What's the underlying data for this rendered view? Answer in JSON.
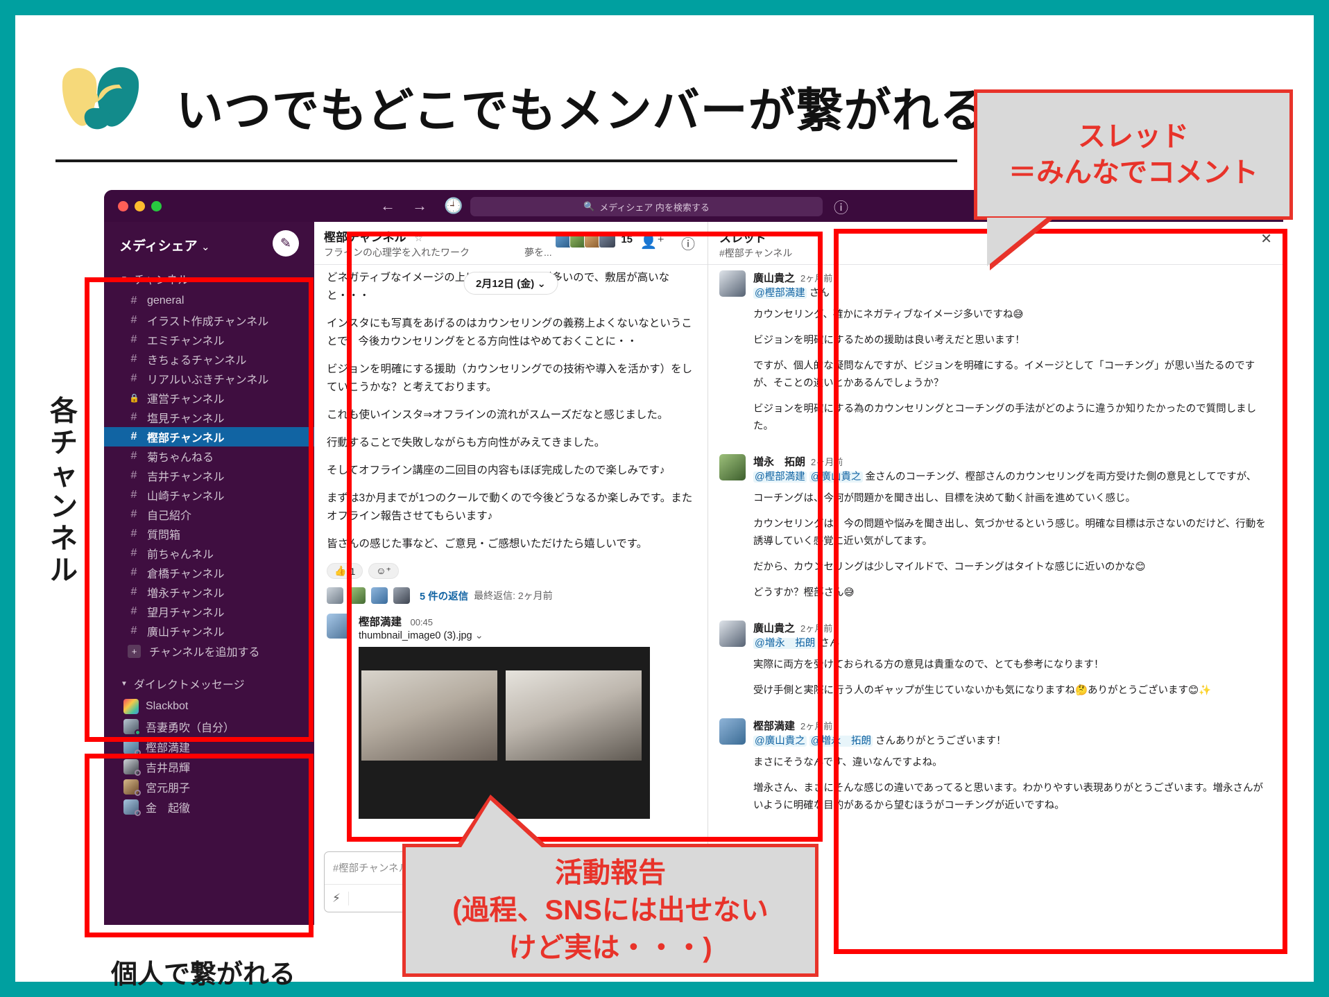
{
  "header": {
    "title": "いつでもどこでもメンバーが繋がれる",
    "logo_icon": "heart-hands-logo"
  },
  "annotations": {
    "channels_label": "各チャンネル",
    "dm_label": "個人で繋がれる",
    "thread_callout_line1": "スレッド",
    "thread_callout_line2": "＝みんなでコメント",
    "report_callout_line1": "活動報告",
    "report_callout_line2": "(過程、SNSには出せない",
    "report_callout_line3": "けど実は・・・)"
  },
  "titlebar": {
    "search_placeholder": "メディシェア 内を検索する",
    "search_icon": "search-icon",
    "back_icon": "arrow-left-icon",
    "forward_icon": "arrow-right-icon",
    "history_icon": "clock-icon",
    "help_icon": "help-circle-icon"
  },
  "sidebar": {
    "workspace_name": "メディシェア",
    "workspace_caret": "⌄",
    "compose_icon": "compose-icon",
    "channels_section": "チャンネル",
    "channels": [
      {
        "name": "general",
        "icon": "hash-icon",
        "active": false
      },
      {
        "name": "イラスト作成チャンネル",
        "icon": "hash-icon",
        "active": false
      },
      {
        "name": "エミチャンネル",
        "icon": "hash-icon",
        "active": false
      },
      {
        "name": "きちょるチャンネル",
        "icon": "hash-icon",
        "active": false
      },
      {
        "name": "リアルいぶきチャンネル",
        "icon": "hash-icon",
        "active": false
      },
      {
        "name": "運営チャンネル",
        "icon": "lock-icon",
        "active": false
      },
      {
        "name": "塩見チャンネル",
        "icon": "hash-icon",
        "active": false
      },
      {
        "name": "樫部チャンネル",
        "icon": "hash-icon",
        "active": true
      },
      {
        "name": "菊ちゃんねる",
        "icon": "hash-icon",
        "active": false
      },
      {
        "name": "吉井チャンネル",
        "icon": "hash-icon",
        "active": false
      },
      {
        "name": "山崎チャンネル",
        "icon": "hash-icon",
        "active": false
      },
      {
        "name": "自己紹介",
        "icon": "hash-icon",
        "active": false
      },
      {
        "name": "質問箱",
        "icon": "hash-icon",
        "active": false
      },
      {
        "name": "前ちゃんネル",
        "icon": "hash-icon",
        "active": false
      },
      {
        "name": "倉橋チャンネル",
        "icon": "hash-icon",
        "active": false
      },
      {
        "name": "増永チャンネル",
        "icon": "hash-icon",
        "active": false
      },
      {
        "name": "望月チャンネル",
        "icon": "hash-icon",
        "active": false
      },
      {
        "name": "廣山チャンネル",
        "icon": "hash-icon",
        "active": false
      }
    ],
    "add_channel": "チャンネルを追加する",
    "dm_section": "ダイレクトメッセージ",
    "dms": [
      {
        "name": "Slackbot",
        "presence": "none"
      },
      {
        "name": "吾妻勇吹（自分）",
        "presence": "online"
      },
      {
        "name": "樫部満建",
        "presence": "offline"
      },
      {
        "name": "吉井昂輝",
        "presence": "offline"
      },
      {
        "name": "宮元朋子",
        "presence": "offline"
      },
      {
        "name": "金　起徹",
        "presence": "offline"
      }
    ]
  },
  "channel": {
    "title": "樫部チャンネル",
    "star_icon": "star-icon",
    "topic": "フラインの心理学を入れたワーク",
    "topic_right": "夢を...",
    "member_count": "15",
    "add_member_icon": "add-person-icon",
    "info_icon": "info-icon",
    "date_divider": "2月12日 (金)",
    "messages": [
      "どネガティブなイメージの上に使用するこンが多いので、敷居が高いなと・・・",
      "インスタにも写真をあげるのはカウンセリングの義務上よくないなということで、今後カウンセリングをとる方向性はやめておくことに・・",
      "ビジョンを明確にする援助（カウンセリングでの技術や導入を活かす）をしていこうかな？と考えております。",
      "これも使いインスタ⇒オフラインの流れがスムーズだなと感じました。",
      "行動することで失敗しながらも方向性がみえてきました。",
      "そしてオフライン講座の二回目の内容もほぼ完成したので楽しみです♪",
      "まずは3か月までが1つのクールで動くので今後どうなるか楽しみです。またオフライン報告させてもらいます♪",
      "皆さんの感じた事など、ご意見・ご感想いただけたら嬉しいです。"
    ],
    "reaction_emoji": "👍",
    "reaction_count": "1",
    "add_reaction_icon": "add-reaction-icon",
    "thread_replies": "5 件の返信",
    "thread_last": "最終返信: 2ヶ月前",
    "post": {
      "author": "樫部満建",
      "time": "00:45",
      "filename": "thumbnail_image0 (3).jpg",
      "caret_icon": "chevron-down-icon"
    },
    "composer_placeholder": "#樫部チャンネル へのメッセージ",
    "composer_icon": "lightning-icon"
  },
  "thread": {
    "title": "スレッド",
    "subtitle": "#樫部チャンネル",
    "close_icon": "close-icon",
    "messages": [
      {
        "author": "廣山貴之",
        "time": "2ヶ月前",
        "mentions": [
          "@樫部満建"
        ],
        "mention_suffix": " さん",
        "paragraphs": [
          "カウンセリング、確かにネガティブなイメージ多いですね😅",
          "ビジョンを明確にするための援助は良い考えだと思います！",
          "ですが、個人的な疑問なんですが、ビジョンを明確にする。イメージとして「コーチング」が思い当たるのですが、そことの違いとかあるんでしょうか？",
          "ビジョンを明確にする為のカウンセリングとコーチングの手法がどのように違うか知りたかったので質問しました。"
        ]
      },
      {
        "author": "増永　拓朗",
        "time": "2ヶ月前",
        "mentions": [
          "@樫部満建",
          "@廣山貴之"
        ],
        "mention_suffix": " 金さんのコーチング、樫部さんのカウンセリングを両方受けた側の意見としてですが、",
        "paragraphs": [
          "コーチングは、今何が問題かを聞き出し、目標を決めて動く計画を進めていく感じ。",
          "カウンセリングは、今の問題や悩みを聞き出し、気づかせるという感じ。明確な目標は示さないのだけど、行動を誘導していく感覚に近い気がしてます。",
          "だから、カウンセリングは少しマイルドで、コーチングはタイトな感じに近いのかな😊",
          "どうすか？樫部さん😅"
        ]
      },
      {
        "author": "廣山貴之",
        "time": "2ヶ月前",
        "mentions": [
          "@増永　拓朗"
        ],
        "mention_suffix": " さん",
        "paragraphs": [
          "実際に両方を受けておられる方の意見は貴重なので、とても参考になります！",
          "受け手側と実際に行う人のギャップが生じていないかも気になりますね🤔ありがとうございます😊✨"
        ]
      },
      {
        "author": "樫部満建",
        "time": "2ヶ月前",
        "mentions": [
          "@廣山貴之",
          "@増永　拓朗"
        ],
        "mention_suffix": " さんありがとうございます！",
        "paragraphs": [
          "まさにそうなんです、違いなんですよね。",
          "増永さん、まさにそんな感じの違いであってると思います。わかりやすい表現ありがとうございます。増永さんがいように明確な目的があるから望むほうがコーチングが近いですね。"
        ]
      }
    ]
  },
  "colors": {
    "teal": "#00a0a0",
    "slack_purple": "#3f0e40",
    "slack_active": "#1164a3",
    "annotation_red": "#ff0000",
    "callout_red": "#e8332a",
    "callout_gray": "#d9d9d9",
    "link_blue": "#1264a3"
  }
}
